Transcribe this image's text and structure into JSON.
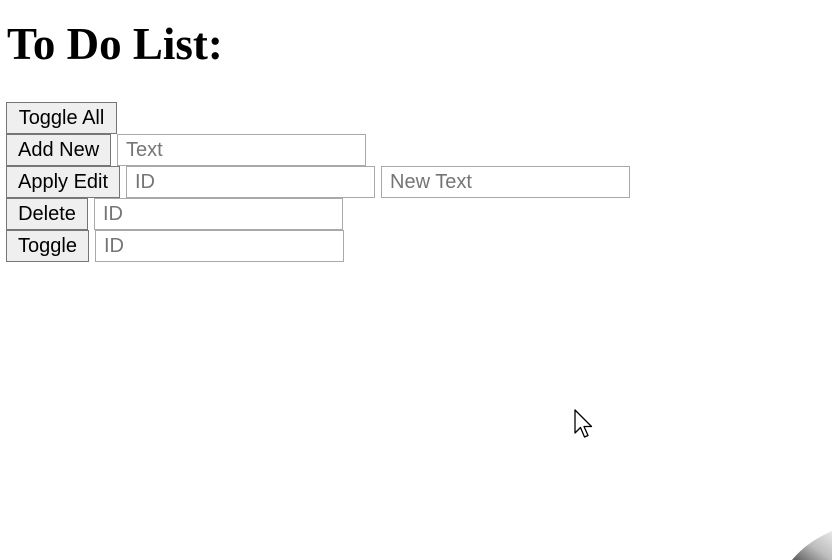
{
  "page": {
    "title": "To Do List:"
  },
  "controls": {
    "toggle_all": {
      "label": "Toggle All"
    },
    "add_new": {
      "label": "Add New",
      "text_placeholder": "Text"
    },
    "apply_edit": {
      "label": "Apply Edit",
      "id_placeholder": "ID",
      "new_text_placeholder": "New Text"
    },
    "delete": {
      "label": "Delete",
      "id_placeholder": "ID"
    },
    "toggle": {
      "label": "Toggle",
      "id_placeholder": "ID"
    }
  },
  "icons": {
    "cursor": "mouse-pointer-icon"
  },
  "colors": {
    "button_bg": "#efefef",
    "button_border": "#767676",
    "input_border": "#a9a9a9",
    "placeholder": "#757575",
    "text": "#000000"
  }
}
